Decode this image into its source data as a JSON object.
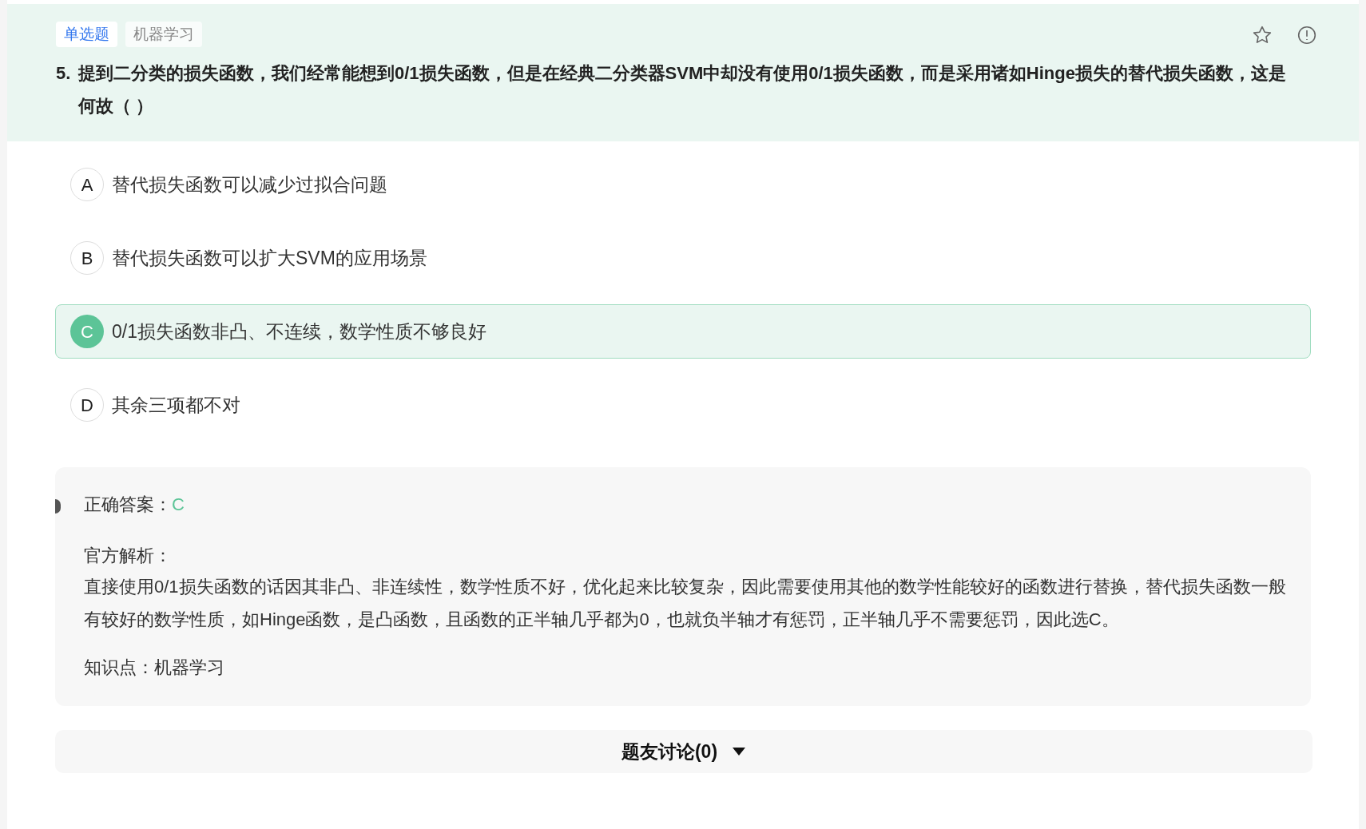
{
  "question": {
    "tags": [
      {
        "label": "单选题",
        "kind": "type"
      },
      {
        "label": "机器学习",
        "kind": "topic"
      }
    ],
    "number": "5.",
    "text": "提到二分类的损失函数，我们经常能想到0/1损失函数，但是在经典二分类器SVM中却没有使用0/1损失函数，而是采用诸如Hinge损失的替代损失函数，这是何故（ ）"
  },
  "options": [
    {
      "letter": "A",
      "text": "替代损失函数可以减少过拟合问题",
      "selected": false
    },
    {
      "letter": "B",
      "text": "替代损失函数可以扩大SVM的应用场景",
      "selected": false
    },
    {
      "letter": "C",
      "text": "0/1损失函数非凸、不连续，数学性质不够良好",
      "selected": true
    },
    {
      "letter": "D",
      "text": "其余三项都不对",
      "selected": false
    }
  ],
  "answer": {
    "label": "正确答案：",
    "value": "C",
    "analysis_label": "官方解析：",
    "analysis": "直接使用0/1损失函数的话因其非凸、非连续性，数学性质不好，优化起来比较复杂，因此需要使用其他的数学性能较好的函数进行替换，替代损失函数一般有较好的数学性质，如Hinge函数，是凸函数，且函数的正半轴几乎都为0，也就负半轴才有惩罚，正半轴几乎不需要惩罚，因此选C。",
    "knowledge": "知识点：机器学习"
  },
  "discussion": {
    "label": "题友讨论(0)",
    "expanded": false
  }
}
